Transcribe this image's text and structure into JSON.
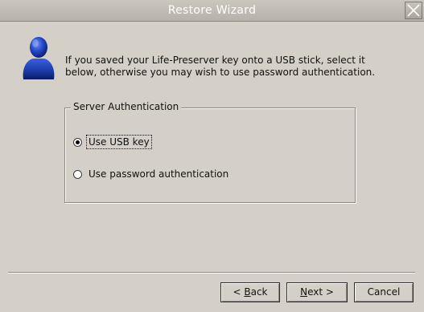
{
  "window": {
    "title": "Restore Wizard"
  },
  "icons": {
    "user": "user-icon",
    "close": "close-icon"
  },
  "intro": {
    "line1": "If you saved your Life-Preserver key onto a USB stick, select it",
    "line2": "below, otherwise you may wish to use password authentication."
  },
  "auth_group": {
    "legend": "Server Authentication",
    "options": [
      {
        "label": "Use USB key",
        "checked": true
      },
      {
        "label": "Use password authentication",
        "checked": false
      }
    ]
  },
  "buttons": {
    "back": {
      "prefix": "< ",
      "mnemonic": "B",
      "rest": "ack"
    },
    "next": {
      "prefix": "",
      "mnemonic": "N",
      "rest": "ext >"
    },
    "cancel": {
      "label": "Cancel"
    }
  },
  "colors": {
    "background": "#d4d0c8",
    "title_text": "#ffffff",
    "icon_blue": "#2247c9"
  }
}
